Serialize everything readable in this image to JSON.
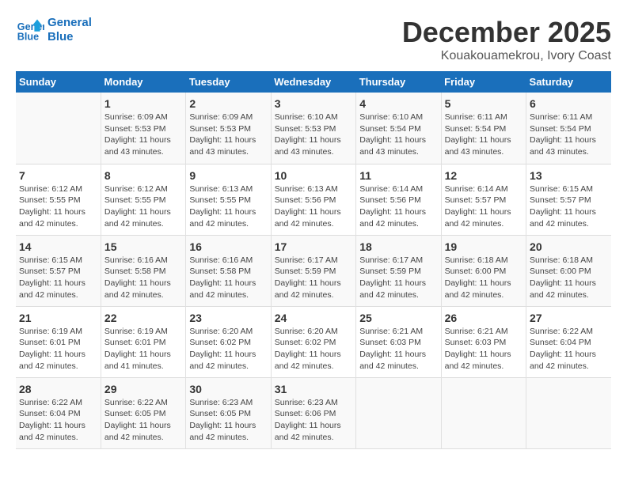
{
  "logo": {
    "line1": "General",
    "line2": "Blue"
  },
  "title": "December 2025",
  "subtitle": "Kouakouamekrou, Ivory Coast",
  "weekdays": [
    "Sunday",
    "Monday",
    "Tuesday",
    "Wednesday",
    "Thursday",
    "Friday",
    "Saturday"
  ],
  "weeks": [
    [
      {
        "day": "",
        "info": ""
      },
      {
        "day": "1",
        "info": "Sunrise: 6:09 AM\nSunset: 5:53 PM\nDaylight: 11 hours\nand 43 minutes."
      },
      {
        "day": "2",
        "info": "Sunrise: 6:09 AM\nSunset: 5:53 PM\nDaylight: 11 hours\nand 43 minutes."
      },
      {
        "day": "3",
        "info": "Sunrise: 6:10 AM\nSunset: 5:53 PM\nDaylight: 11 hours\nand 43 minutes."
      },
      {
        "day": "4",
        "info": "Sunrise: 6:10 AM\nSunset: 5:54 PM\nDaylight: 11 hours\nand 43 minutes."
      },
      {
        "day": "5",
        "info": "Sunrise: 6:11 AM\nSunset: 5:54 PM\nDaylight: 11 hours\nand 43 minutes."
      },
      {
        "day": "6",
        "info": "Sunrise: 6:11 AM\nSunset: 5:54 PM\nDaylight: 11 hours\nand 43 minutes."
      }
    ],
    [
      {
        "day": "7",
        "info": "Sunrise: 6:12 AM\nSunset: 5:55 PM\nDaylight: 11 hours\nand 42 minutes."
      },
      {
        "day": "8",
        "info": "Sunrise: 6:12 AM\nSunset: 5:55 PM\nDaylight: 11 hours\nand 42 minutes."
      },
      {
        "day": "9",
        "info": "Sunrise: 6:13 AM\nSunset: 5:55 PM\nDaylight: 11 hours\nand 42 minutes."
      },
      {
        "day": "10",
        "info": "Sunrise: 6:13 AM\nSunset: 5:56 PM\nDaylight: 11 hours\nand 42 minutes."
      },
      {
        "day": "11",
        "info": "Sunrise: 6:14 AM\nSunset: 5:56 PM\nDaylight: 11 hours\nand 42 minutes."
      },
      {
        "day": "12",
        "info": "Sunrise: 6:14 AM\nSunset: 5:57 PM\nDaylight: 11 hours\nand 42 minutes."
      },
      {
        "day": "13",
        "info": "Sunrise: 6:15 AM\nSunset: 5:57 PM\nDaylight: 11 hours\nand 42 minutes."
      }
    ],
    [
      {
        "day": "14",
        "info": "Sunrise: 6:15 AM\nSunset: 5:57 PM\nDaylight: 11 hours\nand 42 minutes."
      },
      {
        "day": "15",
        "info": "Sunrise: 6:16 AM\nSunset: 5:58 PM\nDaylight: 11 hours\nand 42 minutes."
      },
      {
        "day": "16",
        "info": "Sunrise: 6:16 AM\nSunset: 5:58 PM\nDaylight: 11 hours\nand 42 minutes."
      },
      {
        "day": "17",
        "info": "Sunrise: 6:17 AM\nSunset: 5:59 PM\nDaylight: 11 hours\nand 42 minutes."
      },
      {
        "day": "18",
        "info": "Sunrise: 6:17 AM\nSunset: 5:59 PM\nDaylight: 11 hours\nand 42 minutes."
      },
      {
        "day": "19",
        "info": "Sunrise: 6:18 AM\nSunset: 6:00 PM\nDaylight: 11 hours\nand 42 minutes."
      },
      {
        "day": "20",
        "info": "Sunrise: 6:18 AM\nSunset: 6:00 PM\nDaylight: 11 hours\nand 42 minutes."
      }
    ],
    [
      {
        "day": "21",
        "info": "Sunrise: 6:19 AM\nSunset: 6:01 PM\nDaylight: 11 hours\nand 42 minutes."
      },
      {
        "day": "22",
        "info": "Sunrise: 6:19 AM\nSunset: 6:01 PM\nDaylight: 11 hours\nand 41 minutes."
      },
      {
        "day": "23",
        "info": "Sunrise: 6:20 AM\nSunset: 6:02 PM\nDaylight: 11 hours\nand 42 minutes."
      },
      {
        "day": "24",
        "info": "Sunrise: 6:20 AM\nSunset: 6:02 PM\nDaylight: 11 hours\nand 42 minutes."
      },
      {
        "day": "25",
        "info": "Sunrise: 6:21 AM\nSunset: 6:03 PM\nDaylight: 11 hours\nand 42 minutes."
      },
      {
        "day": "26",
        "info": "Sunrise: 6:21 AM\nSunset: 6:03 PM\nDaylight: 11 hours\nand 42 minutes."
      },
      {
        "day": "27",
        "info": "Sunrise: 6:22 AM\nSunset: 6:04 PM\nDaylight: 11 hours\nand 42 minutes."
      }
    ],
    [
      {
        "day": "28",
        "info": "Sunrise: 6:22 AM\nSunset: 6:04 PM\nDaylight: 11 hours\nand 42 minutes."
      },
      {
        "day": "29",
        "info": "Sunrise: 6:22 AM\nSunset: 6:05 PM\nDaylight: 11 hours\nand 42 minutes."
      },
      {
        "day": "30",
        "info": "Sunrise: 6:23 AM\nSunset: 6:05 PM\nDaylight: 11 hours\nand 42 minutes."
      },
      {
        "day": "31",
        "info": "Sunrise: 6:23 AM\nSunset: 6:06 PM\nDaylight: 11 hours\nand 42 minutes."
      },
      {
        "day": "",
        "info": ""
      },
      {
        "day": "",
        "info": ""
      },
      {
        "day": "",
        "info": ""
      }
    ]
  ]
}
